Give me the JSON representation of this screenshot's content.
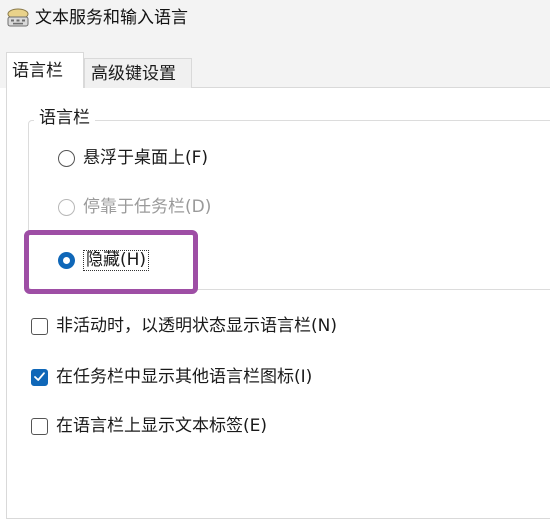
{
  "window": {
    "title": "文本服务和输入语言",
    "icon": "keyboard-app-icon"
  },
  "tabs": [
    {
      "label": "语言栏",
      "selected": true
    },
    {
      "label": "高级键设置",
      "selected": false
    }
  ],
  "language_bar_group": {
    "title": "语言栏",
    "options": [
      {
        "label": "悬浮于桌面上(F)",
        "hotkey": "F",
        "selected": false,
        "enabled": true
      },
      {
        "label": "停靠于任务栏(D)",
        "hotkey": "D",
        "selected": false,
        "enabled": false
      },
      {
        "label": "隐藏(H)",
        "hotkey": "H",
        "selected": true,
        "enabled": true
      }
    ]
  },
  "checkboxes": [
    {
      "label": "非活动时，以透明状态显示语言栏(N)",
      "checked": false
    },
    {
      "label": "在任务栏中显示其他语言栏图标(I)",
      "checked": true
    },
    {
      "label": "在语言栏上显示文本标签(E)",
      "checked": false
    }
  ],
  "colors": {
    "accent": "#0f67b8",
    "highlight_annotation": "#9e4ea5",
    "disabled_text": "#9a9a9a",
    "chrome_background": "#f3f3f3"
  }
}
